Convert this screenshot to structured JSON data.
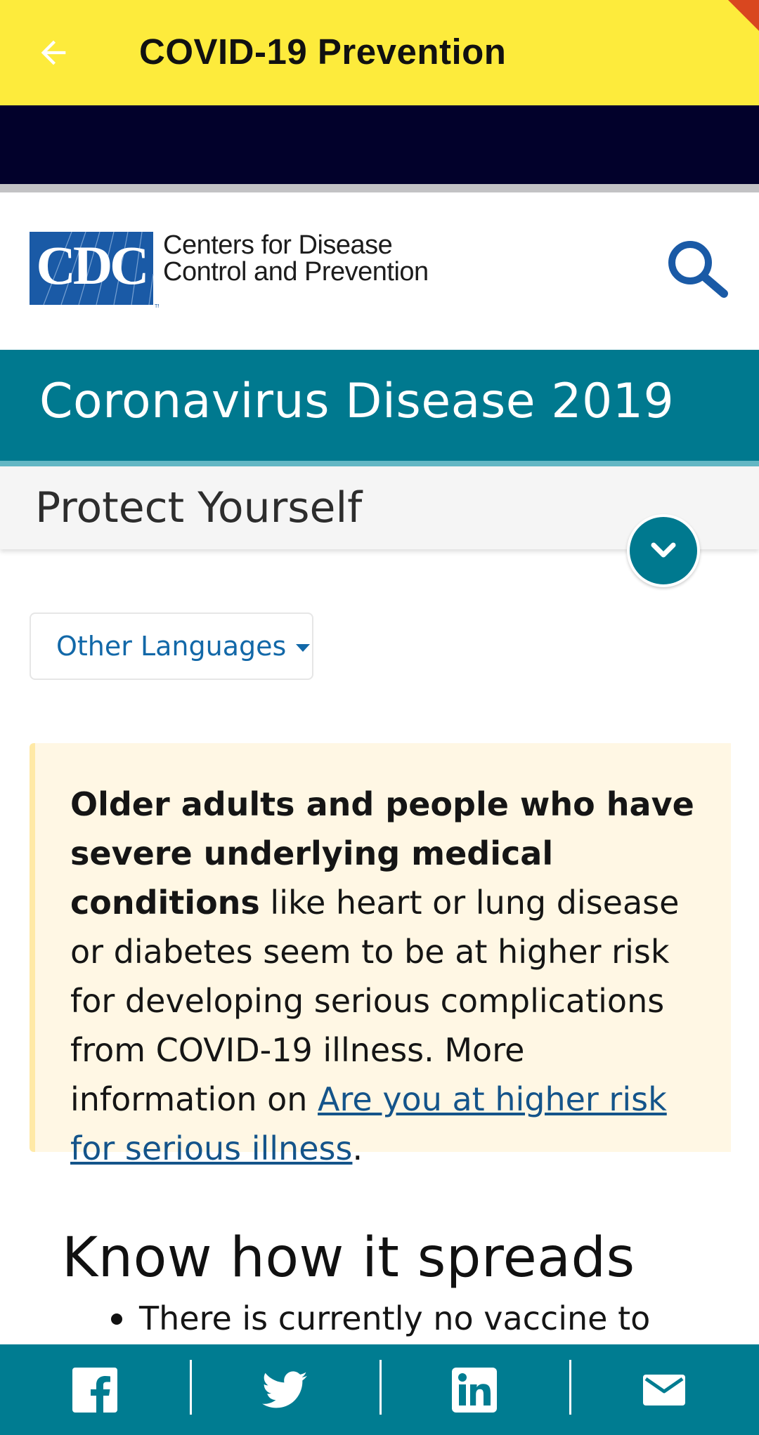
{
  "app_bar": {
    "title": "COVID-19 Prevention",
    "background_color": "#fdeb3c",
    "back_icon": "arrow-left-icon"
  },
  "header": {
    "logo_text": "CDC",
    "org_name_line1": "Centers for Disease",
    "org_name_line2": "Control and Prevention",
    "search_icon": "search-icon",
    "brand_color": "#1a5aa6"
  },
  "banner": {
    "title": "Coronavirus Disease 2019",
    "color": "#00798f"
  },
  "section": {
    "title": "Protect Yourself",
    "toggle_icon": "chevron-down-icon"
  },
  "languages": {
    "label": "Other Languages"
  },
  "callout": {
    "bold_text": "Older adults and people who have severe underlying medical conditions",
    "body_text": " like heart or lung disease or diabetes seem to be at higher risk for developing serious complications from COVID-19 illness. More information on ",
    "link_text": "Are you at higher risk for serious illness",
    "end_text": "."
  },
  "content": {
    "heading": "Know how it spreads",
    "bullets": [
      "There is currently no vaccine to"
    ]
  },
  "share_bar": {
    "color": "#007c91",
    "items": [
      "facebook-icon",
      "twitter-icon",
      "linkedin-icon",
      "email-icon"
    ]
  }
}
